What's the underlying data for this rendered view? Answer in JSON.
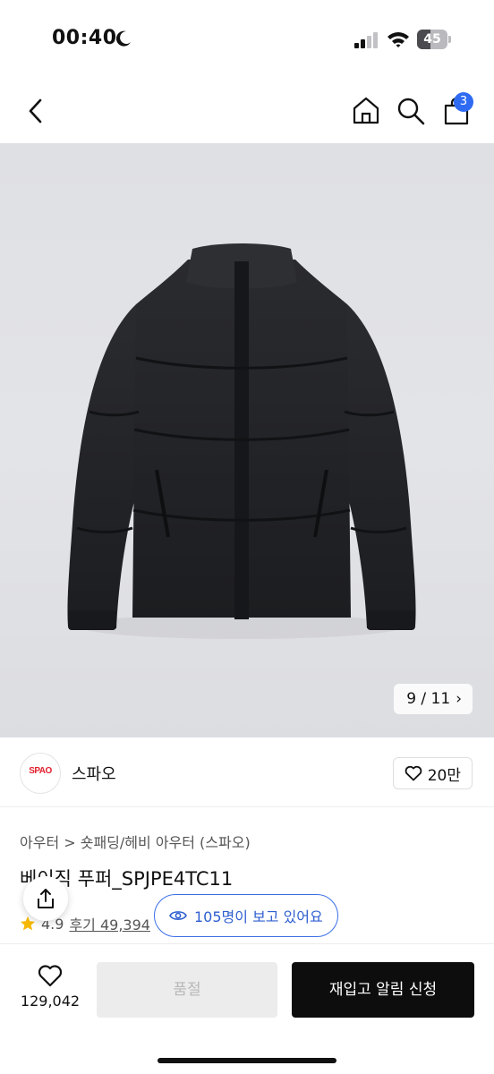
{
  "status_bar": {
    "time": "00:40",
    "battery_level": "45",
    "battery_fraction": 0.45
  },
  "nav": {
    "cart_count": "3",
    "icons": [
      "back-icon",
      "home-icon",
      "search-icon",
      "cart-icon"
    ],
    "badge_color": "#2f6bf2"
  },
  "gallery": {
    "counter": "9 / 11",
    "counter_arrow": "›"
  },
  "brand": {
    "logo_text": "SPAO",
    "name": "스파오",
    "likes": "20만",
    "logo_color": "#e2202d"
  },
  "product": {
    "breadcrumb": "아우터 > 숏패딩/헤비 아우터 (스파오)",
    "title": "베이직 푸퍼_SPJPE4TC11",
    "rating": "4.9",
    "review_label": "후기 49,394"
  },
  "viewers": {
    "text": "105명이 보고 있어요",
    "accent": "#2f5fd0"
  },
  "bottom_bar": {
    "wish_count": "129,042",
    "soldout_label": "품절",
    "restock_label": "재입고 알림 신청"
  }
}
